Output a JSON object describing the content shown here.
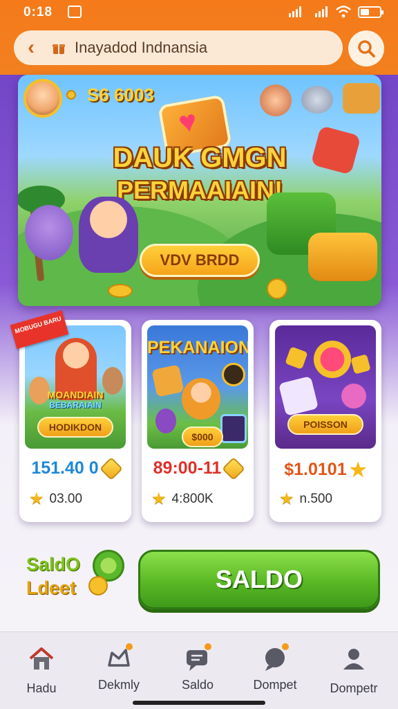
{
  "status": {
    "time": "0:18"
  },
  "header": {
    "url_text": "Inayadod Indnansia",
    "icons": {
      "back": "chevron-left-icon",
      "site": "gift-icon",
      "search": "search-icon"
    }
  },
  "banner": {
    "balance": "S6 6003",
    "title_line1": "DAUK GMGN",
    "title_line2": "PERMAAIAIN!",
    "cta_label": "VDV BRDD"
  },
  "cards": [
    {
      "badge": "MOBUGU BARU",
      "art_title": "MOANDIAIN",
      "art_subtitle": "BEBARAIAIN",
      "button": "HODIKDON",
      "price": "151.40 0",
      "price_color": "#1e88d8",
      "rating": "03.00"
    },
    {
      "art_title": "PEKANAION",
      "button": "$000",
      "price": "89:00-11",
      "price_color": "#e0302a",
      "rating": "4:800K"
    },
    {
      "button": "POISSON",
      "price": "$1.0101",
      "price_color": "#e0561a",
      "rating": "n.500"
    }
  ],
  "wallet": {
    "label_line1": "SaldO",
    "label_line2": "Ldeet",
    "button_label": "SALDO"
  },
  "nav": [
    {
      "label": "Hadu",
      "icon": "home-icon"
    },
    {
      "label": "Dekmly",
      "icon": "gamepad-icon"
    },
    {
      "label": "Saldo",
      "icon": "chat-icon"
    },
    {
      "label": "Dompet",
      "icon": "message-icon"
    },
    {
      "label": "Dompetr",
      "icon": "user-icon"
    }
  ],
  "colors": {
    "header": "#f57a1a",
    "accent_green": "#5ab825",
    "coin": "#f5c02a"
  }
}
